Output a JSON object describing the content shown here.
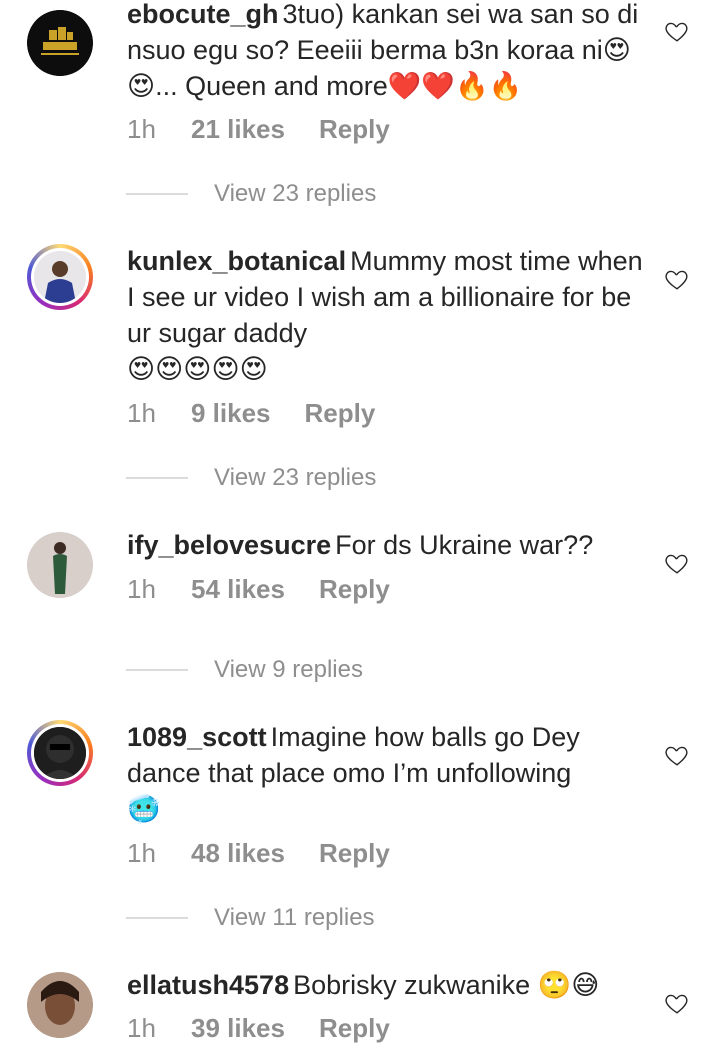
{
  "comments": [
    {
      "username": "ebocute_gh",
      "text": "3tuo) kankan sei wa san so di nsuo egu so? Eeeiii berma b3n koraa ni😍😍... Queen and more❤️❤️🔥🔥",
      "time": "1h",
      "likes": "21 likes",
      "reply": "Reply",
      "view_replies": "View 23 replies",
      "avatar_text": "EOcute Gh"
    },
    {
      "username": "kunlex_botanical",
      "text": "Mummy most time when I see ur video I wish am a billionaire for be ur sugar daddy",
      "emoji_line": "😍😍😍😍😍",
      "time": "1h",
      "likes": "9 likes",
      "reply": "Reply",
      "view_replies": "View 23 replies"
    },
    {
      "username": "ify_belovesucre",
      "text": "For ds Ukraine war??",
      "time": "1h",
      "likes": "54 likes",
      "reply": "Reply",
      "view_replies": "View 9 replies"
    },
    {
      "username": "1089_scott",
      "text": "Imagine how balls go Dey dance that place omo I’m unfollowing",
      "emoji_line": "🥶",
      "time": "1h",
      "likes": "48 likes",
      "reply": "Reply",
      "view_replies": "View 11 replies"
    },
    {
      "username": "ellatush4578",
      "text": "Bobrisky zukwanike 🙄😅",
      "time": "1h",
      "likes": "39 likes",
      "reply": "Reply"
    }
  ],
  "colors": {
    "text": "#262626",
    "muted": "#8e8e8e",
    "divider": "#dbdbdb"
  },
  "icons": {
    "like": "heart-outline-icon"
  }
}
